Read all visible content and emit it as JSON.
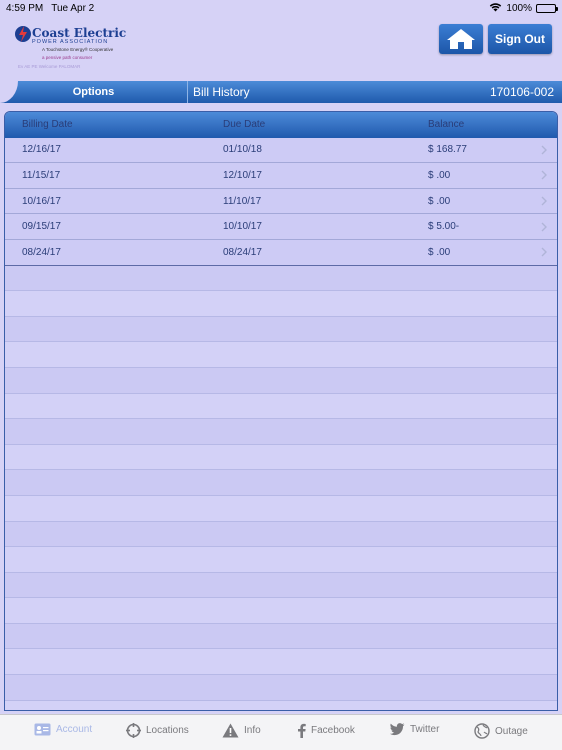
{
  "status_bar": {
    "time": "4:59 PM",
    "date": "Tue Apr 2",
    "battery": "100%"
  },
  "header": {
    "logo": {
      "title": "Coast Electric",
      "subtitle": "POWER ASSOCIATION",
      "tagline": "A Touchstone Energy® Cooperative",
      "line2": "a pensive path   consumer",
      "line3": "Ev AE PE   Welcome PALOMAR"
    },
    "home_icon": "home-icon",
    "sign_out_label": "Sign Out"
  },
  "nav": {
    "options_label": "Options",
    "title": "Bill History",
    "account_number": "170106-002"
  },
  "table": {
    "headers": {
      "billing_date": "Billing Date",
      "due_date": "Due Date",
      "balance": "Balance"
    },
    "rows": [
      {
        "billing_date": "12/16/17",
        "due_date": "01/10/18",
        "balance": "$ 168.77"
      },
      {
        "billing_date": "11/15/17",
        "due_date": "12/10/17",
        "balance": "$ .00"
      },
      {
        "billing_date": "10/16/17",
        "due_date": "11/10/17",
        "balance": "$ .00"
      },
      {
        "billing_date": "09/15/17",
        "due_date": "10/10/17",
        "balance": "$ 5.00-"
      },
      {
        "billing_date": "08/24/17",
        "due_date": "08/24/17",
        "balance": "$ .00"
      }
    ]
  },
  "tab_bar": {
    "tabs": [
      {
        "label": "Account",
        "icon": "account-icon"
      },
      {
        "label": "Locations",
        "icon": "locations-icon"
      },
      {
        "label": "Info",
        "icon": "warning-icon"
      },
      {
        "label": "Facebook",
        "icon": "facebook-icon"
      },
      {
        "label": "Twitter",
        "icon": "twitter-icon"
      },
      {
        "label": "Outage",
        "icon": "globe-icon"
      }
    ],
    "active_tab": "Account"
  },
  "colors": {
    "background": "#d6d2f6",
    "bar_blue": "#2b66b8",
    "text": "#2a3d78"
  }
}
